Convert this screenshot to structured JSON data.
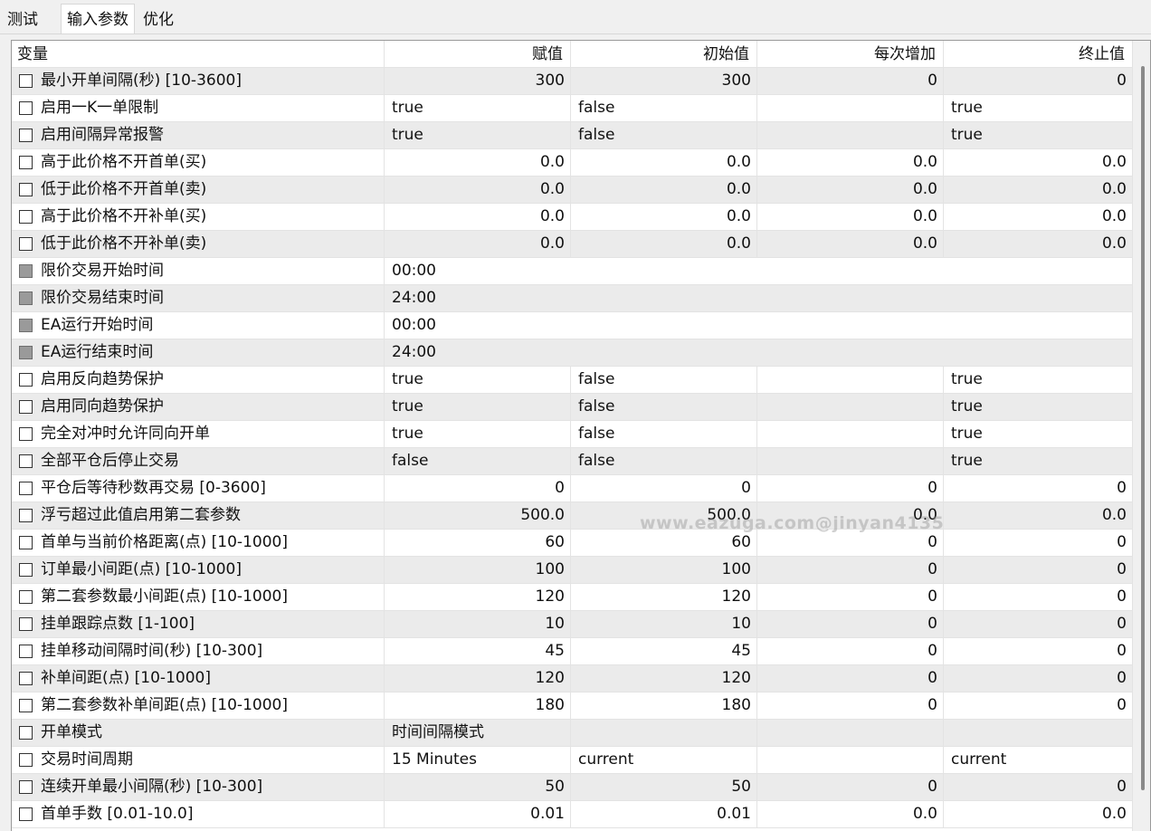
{
  "tabs": [
    {
      "label": "测试"
    },
    {
      "label": "输入参数"
    },
    {
      "label": "优化"
    }
  ],
  "columns": [
    "变量",
    "赋值",
    "初始值",
    "每次增加",
    "终止值"
  ],
  "rows": [
    {
      "name": "最小开单间隔(秒) [10-3600]",
      "value": "300",
      "start": "300",
      "step": "0",
      "stop": "0"
    },
    {
      "name": "启用一K一单限制",
      "value": "true",
      "start": "false",
      "step": "",
      "stop": "true"
    },
    {
      "name": "启用间隔异常报警",
      "value": "true",
      "start": "false",
      "step": "",
      "stop": "true"
    },
    {
      "name": "高于此价格不开首单(买)",
      "value": "0.0",
      "start": "0.0",
      "step": "0.0",
      "stop": "0.0"
    },
    {
      "name": "低于此价格不开首单(卖)",
      "value": "0.0",
      "start": "0.0",
      "step": "0.0",
      "stop": "0.0"
    },
    {
      "name": "高于此价格不开补单(买)",
      "value": "0.0",
      "start": "0.0",
      "step": "0.0",
      "stop": "0.0"
    },
    {
      "name": "低于此价格不开补单(卖)",
      "value": "0.0",
      "start": "0.0",
      "step": "0.0",
      "stop": "0.0"
    },
    {
      "name": "限价交易开始时间",
      "value": "00:00"
    },
    {
      "name": "限价交易结束时间",
      "value": "24:00"
    },
    {
      "name": "EA运行开始时间",
      "value": "00:00"
    },
    {
      "name": "EA运行结束时间",
      "value": "24:00"
    },
    {
      "name": "启用反向趋势保护",
      "value": "true",
      "start": "false",
      "step": "",
      "stop": "true"
    },
    {
      "name": "启用同向趋势保护",
      "value": "true",
      "start": "false",
      "step": "",
      "stop": "true"
    },
    {
      "name": "完全对冲时允许同向开单",
      "value": "true",
      "start": "false",
      "step": "",
      "stop": "true"
    },
    {
      "name": "全部平仓后停止交易",
      "value": "false",
      "start": "false",
      "step": "",
      "stop": "true"
    },
    {
      "name": "平仓后等待秒数再交易 [0-3600]",
      "value": "0",
      "start": "0",
      "step": "0",
      "stop": "0"
    },
    {
      "name": "浮亏超过此值启用第二套参数",
      "value": "500.0",
      "start": "500.0",
      "step": "0.0",
      "stop": "0.0"
    },
    {
      "name": "首单与当前价格距离(点) [10-1000]",
      "value": "60",
      "start": "60",
      "step": "0",
      "stop": "0"
    },
    {
      "name": "订单最小间距(点) [10-1000]",
      "value": "100",
      "start": "100",
      "step": "0",
      "stop": "0"
    },
    {
      "name": "第二套参数最小间距(点) [10-1000]",
      "value": "120",
      "start": "120",
      "step": "0",
      "stop": "0"
    },
    {
      "name": "挂单跟踪点数 [1-100]",
      "value": "10",
      "start": "10",
      "step": "0",
      "stop": "0"
    },
    {
      "name": "挂单移动间隔时间(秒) [10-300]",
      "value": "45",
      "start": "45",
      "step": "0",
      "stop": "0"
    },
    {
      "name": "补单间距(点) [10-1000]",
      "value": "120",
      "start": "120",
      "step": "0",
      "stop": "0"
    },
    {
      "name": "第二套参数补单间距(点) [10-1000]",
      "value": "180",
      "start": "180",
      "step": "0",
      "stop": "0"
    },
    {
      "name": "开单模式",
      "value": "时间间隔模式",
      "start": "",
      "step": "",
      "stop": ""
    },
    {
      "name": "交易时间周期",
      "value": "15 Minutes",
      "start": "current",
      "step": "",
      "stop": "current"
    },
    {
      "name": "连续开单最小间隔(秒) [10-300]",
      "value": "50",
      "start": "50",
      "step": "0",
      "stop": "0"
    },
    {
      "name": "首单手数 [0.01-10.0]",
      "value": "0.01",
      "start": "0.01",
      "step": "0.0",
      "stop": "0.0"
    }
  ],
  "watermark": "www.eazuga.com@jinyan4135"
}
